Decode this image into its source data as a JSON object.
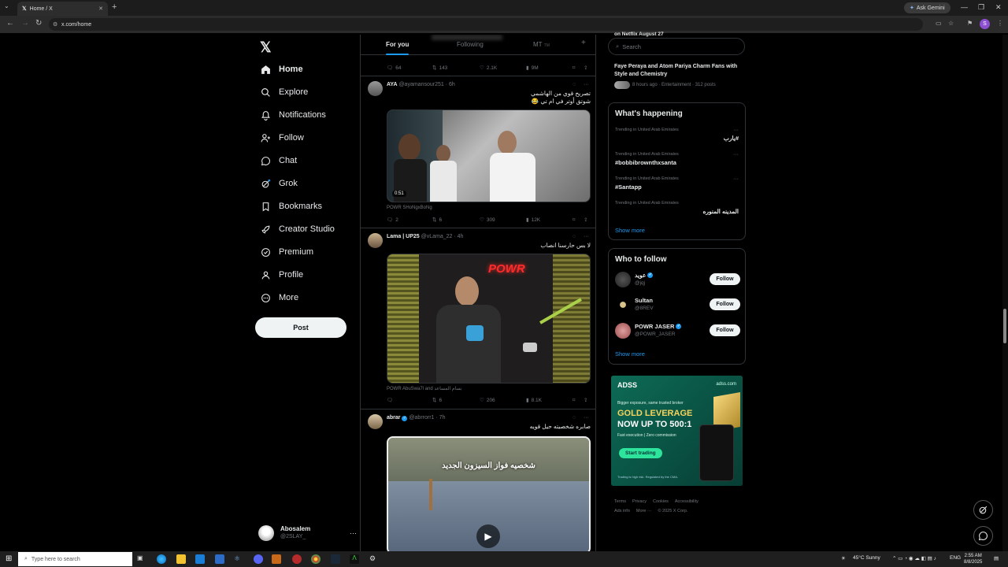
{
  "browser": {
    "tab_title": "Home / X",
    "url": "x.com/home",
    "ask_gemini": "Ask Gemini",
    "profile_initial": "S"
  },
  "sidebar": {
    "items": [
      {
        "label": "Home",
        "icon": "home-icon"
      },
      {
        "label": "Explore",
        "icon": "search-icon"
      },
      {
        "label": "Notifications",
        "icon": "bell-icon"
      },
      {
        "label": "Follow",
        "icon": "person-add-icon"
      },
      {
        "label": "Chat",
        "icon": "chat-icon"
      },
      {
        "label": "Grok",
        "icon": "grok-icon"
      },
      {
        "label": "Bookmarks",
        "icon": "bookmark-icon"
      },
      {
        "label": "Creator Studio",
        "icon": "rocket-icon"
      },
      {
        "label": "Premium",
        "icon": "verified-icon"
      },
      {
        "label": "Profile",
        "icon": "person-icon"
      },
      {
        "label": "More",
        "icon": "more-circle-icon"
      }
    ],
    "post_button": "Post",
    "account": {
      "name": "Abosalem",
      "handle": "@2SLAY_"
    }
  },
  "feed": {
    "tabs": [
      "For you",
      "Following",
      "MT"
    ],
    "tab_sub": "TM",
    "top_actions": {
      "replies": "64",
      "reposts": "143",
      "likes": "2.1K",
      "views": "9M"
    },
    "posts": [
      {
        "name": "AYA",
        "handle": "@ayamansour251",
        "time": "6h",
        "text_line1": "تصريح قوي من الهاشمي",
        "text_line2": "شوتق أوتر في ام تي 😂",
        "duration": "0:51",
        "caption": "POWR SHoNgxBoNg",
        "replies": "2",
        "reposts": "6",
        "likes": "309",
        "views": "12K"
      },
      {
        "name": "Lama | UP25",
        "handle": "@vLama_22",
        "time": "4h",
        "text_line1": "لا بس حارسنا انصاب",
        "caption": "POWR AbuSwa7l and بسام المساعد",
        "neon_sign": "POWR",
        "replies": "",
        "reposts": "6",
        "likes": "206",
        "views": "8.1K"
      },
      {
        "name": "abrar",
        "handle": "@abrrorr1",
        "time": "7h",
        "text_line1": "صابره شخصيته حيل قويه",
        "overlay_text": "شخصيه فواز السيزون الجديد"
      }
    ]
  },
  "right": {
    "search_placeholder": "Search",
    "cut_heading": "on Netflix August 27",
    "top_story": {
      "title": "Faye Peraya and Atom Pariya Charm Fans with Style and Chemistry",
      "meta": "8 hours ago · Entertainment · 312 posts"
    },
    "whats_happening": {
      "title": "What's happening",
      "trends": [
        {
          "meta": "Trending in United Arab Emirates",
          "tag": "#يارب",
          "rtl": true
        },
        {
          "meta": "Trending in United Arab Emirates",
          "tag": "#bobbibrownthxsanta",
          "rtl": false
        },
        {
          "meta": "Trending in United Arab Emirates",
          "tag": "#Santapp",
          "rtl": false
        },
        {
          "meta": "Trending in United Arab Emirates",
          "tag": "المدينه المنوره",
          "rtl": true
        }
      ],
      "show_more": "Show more"
    },
    "who_to_follow": {
      "title": "Who to follow",
      "users": [
        {
          "name": "عويد",
          "handle": "@jqj",
          "verified": true,
          "button": "Follow"
        },
        {
          "name": "Sultan",
          "handle": "@8REV",
          "verified": false,
          "button": "Follow"
        },
        {
          "name": "POWR JASER",
          "handle": "@POWR_JASER",
          "verified": true,
          "button": "Follow"
        }
      ],
      "show_more": "Show more"
    },
    "ad": {
      "brand": "ADSS",
      "site": "adss.com",
      "line1": "Bigger exposure, same trusted broker",
      "line2": "GOLD LEVERAGE",
      "line3": "NOW UP TO 500:1",
      "line4": "Fast execution | Zero commission",
      "cta": "Start trading",
      "disclaimer": "Trading is high risk. Regulated by the CMA."
    },
    "footer": {
      "line1": [
        "Terms",
        "Privacy",
        "Cookies",
        "Accessibility"
      ],
      "ads_info": "Ads info",
      "more": "More ···",
      "copyright": "© 2025 X Corp."
    }
  },
  "taskbar": {
    "search_placeholder": "Type here to search",
    "weather": "45°C  Sunny",
    "lang": "ENG",
    "time": "2:55 AM",
    "date": "8/8/2025"
  },
  "colors": {
    "accent": "#1d9bf0",
    "background": "#000000",
    "border": "#2f3336",
    "muted": "#71767b"
  }
}
